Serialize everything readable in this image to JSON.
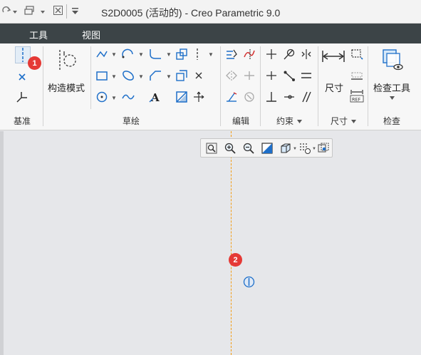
{
  "titlebar": {
    "title": "S2D0005 (活动的) - Creo Parametric 9.0",
    "icons": [
      "redo-icon",
      "window-switch-icon",
      "close-window-icon",
      "customize-icon"
    ]
  },
  "menubar": {
    "items": [
      {
        "label": "工具"
      },
      {
        "label": "视图"
      }
    ]
  },
  "ribbon": {
    "groups": [
      {
        "label": "基准"
      },
      {
        "label": "草绘"
      },
      {
        "label": "编辑"
      },
      {
        "label": "约束"
      },
      {
        "label": "尺寸"
      },
      {
        "label": "检查"
      }
    ],
    "construction_mode_label": "构造模式",
    "dimension_label": "尺寸",
    "inspect_tools_label": "检查工具",
    "ref_tag": "REF"
  },
  "canvas": {
    "badges": [
      {
        "text": "1"
      },
      {
        "text": "2"
      }
    ]
  },
  "colors": {
    "menubar_bg": "#3c4447",
    "centerline": "#f39c12",
    "badge": "#e53935",
    "icon_blue": "#1e6fc9"
  }
}
